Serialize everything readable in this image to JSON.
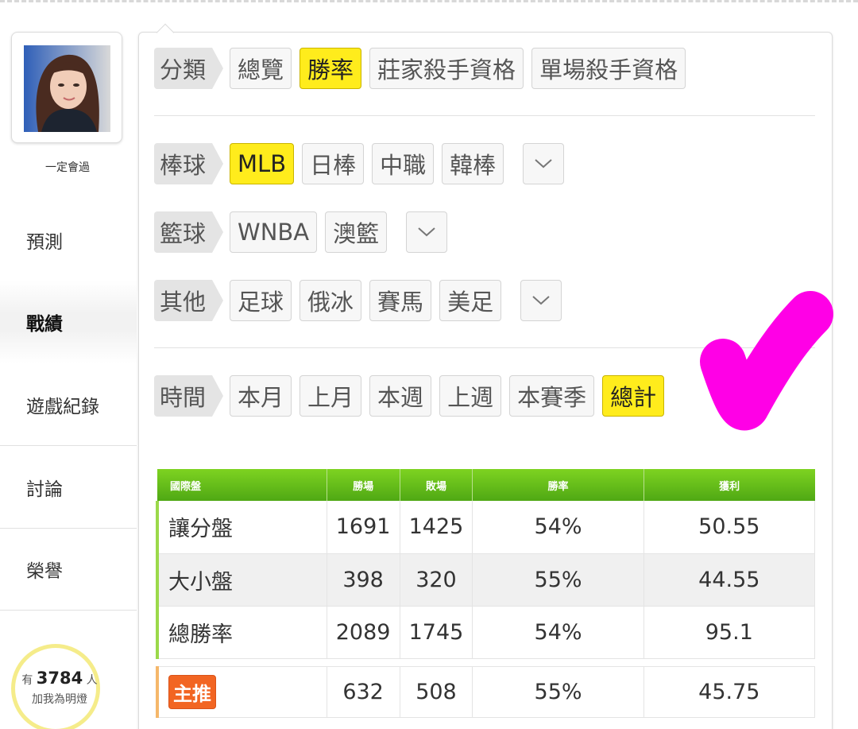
{
  "user": {
    "name": "一定會過"
  },
  "nav": [
    {
      "label": "預測"
    },
    {
      "label": "戰績"
    },
    {
      "label": "遊戲紀錄"
    },
    {
      "label": "討論"
    },
    {
      "label": "榮譽"
    }
  ],
  "fans": {
    "prefix": "有",
    "count": "3784",
    "suffix": "人",
    "cta": "加我為明燈"
  },
  "filters": {
    "category": {
      "label": "分類",
      "options": [
        "總覽",
        "勝率",
        "莊家殺手資格",
        "單場殺手資格"
      ],
      "selected": "勝率"
    },
    "baseball": {
      "label": "棒球",
      "options": [
        "MLB",
        "日棒",
        "中職",
        "韓棒"
      ],
      "selected": "MLB"
    },
    "basketball": {
      "label": "籃球",
      "options": [
        "WNBA",
        "澳籃"
      ]
    },
    "other": {
      "label": "其他",
      "options": [
        "足球",
        "俄冰",
        "賽馬",
        "美足"
      ]
    },
    "time": {
      "label": "時間",
      "options": [
        "本月",
        "上月",
        "本週",
        "上週",
        "本賽季",
        "總計"
      ],
      "selected": "總計"
    }
  },
  "table": {
    "headers": [
      "國際盤",
      "勝場",
      "敗場",
      "勝率",
      "獲利"
    ],
    "rows": [
      {
        "type": "讓分盤",
        "wins": "1691",
        "losses": "1425",
        "rate": "54%",
        "profit": "50.55"
      },
      {
        "type": "大小盤",
        "wins": "398",
        "losses": "320",
        "rate": "55%",
        "profit": "44.55"
      },
      {
        "type": "總勝率",
        "wins": "2089",
        "losses": "1745",
        "rate": "54%",
        "profit": "95.1"
      }
    ],
    "featured": {
      "badge": "主推",
      "wins": "632",
      "losses": "508",
      "rate": "55%",
      "profit": "45.75"
    }
  },
  "colors": {
    "accent_yellow": "#ffec1c",
    "header_green": "#6cc21b",
    "badge_orange": "#f26522",
    "annotation_magenta": "#ff00e6"
  },
  "icons": {
    "dropdown": "chevron-down-icon"
  }
}
